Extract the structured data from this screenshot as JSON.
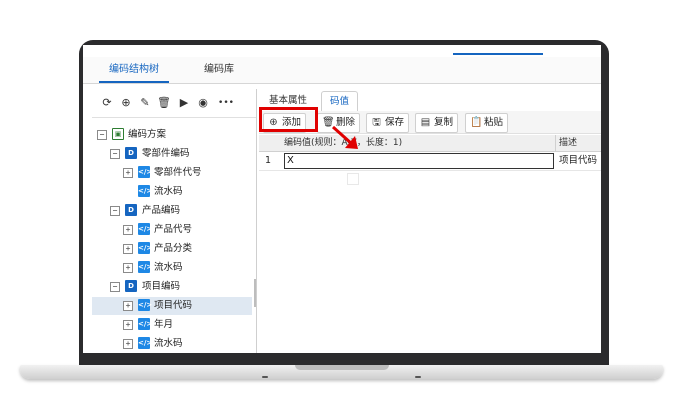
{
  "top_tabs": [
    "编码结构树",
    "编码库"
  ],
  "left_toolbar": {
    "icons": [
      "refresh-icon",
      "add-circle-icon",
      "edit-icon",
      "delete-icon",
      "play-icon",
      "stop-icon",
      "more-icon"
    ],
    "glyphs": [
      "⟳",
      "⊕",
      "✎",
      "🗑",
      "▶",
      "◉",
      "•••"
    ]
  },
  "tree": {
    "root": "编码方案",
    "groups": [
      {
        "label": "零部件编码",
        "items": [
          "零部件代号",
          "流水码"
        ]
      },
      {
        "label": "产品编码",
        "items": [
          "产品代号",
          "产品分类",
          "流水码"
        ]
      },
      {
        "label": "项目编码",
        "items": [
          "项目代码",
          "年月",
          "流水码"
        ]
      }
    ],
    "selected": "项目代码"
  },
  "sub_tabs": [
    "基本属性",
    "码值"
  ],
  "actions": [
    {
      "label": "添加",
      "icon": "⊕"
    },
    {
      "label": "删除",
      "icon": "🗑"
    },
    {
      "label": "保存",
      "icon": "🖫"
    },
    {
      "label": "复制",
      "icon": "▤"
    },
    {
      "label": "粘贴",
      "icon": "📋"
    }
  ],
  "grid": {
    "headers": [
      "编码值(规则：A-Z，长度：1)",
      "描述"
    ],
    "rows": [
      {
        "index": "1",
        "value": "X",
        "description": "项目代码"
      }
    ]
  },
  "colors": {
    "accent": "#1565c0",
    "highlight": "#e00000"
  }
}
